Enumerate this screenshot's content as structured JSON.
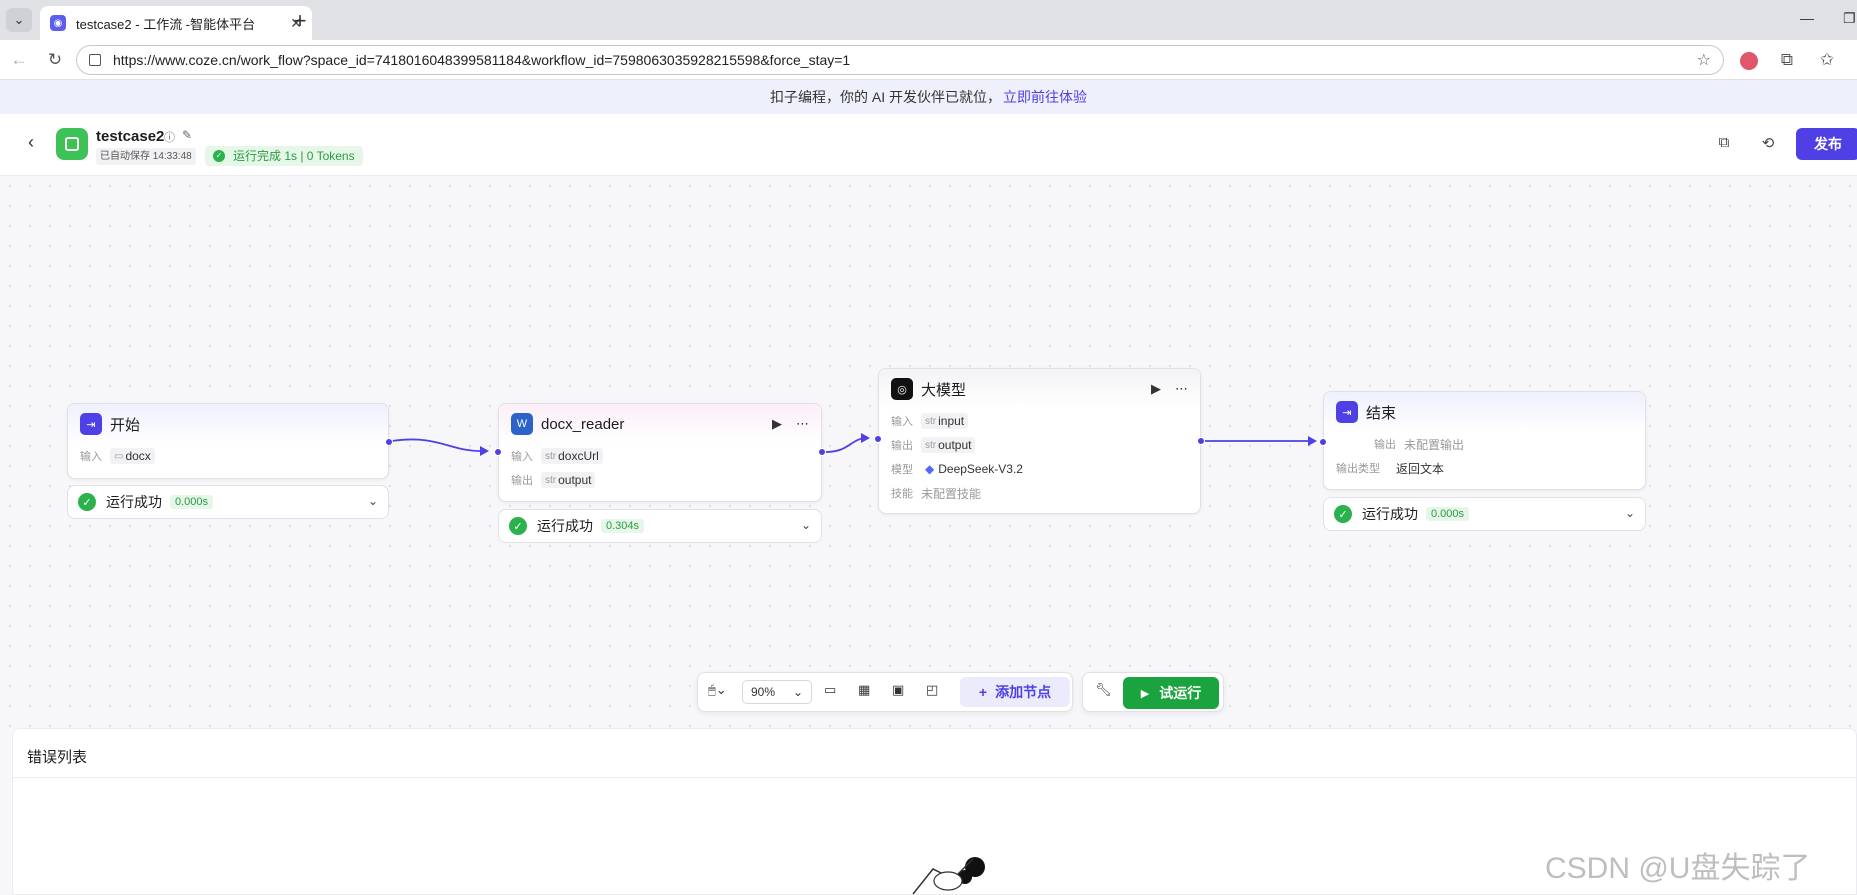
{
  "browser": {
    "tab_title": "testcase2 - 工作流 -智能体平台",
    "url": "https://www.coze.cn/work_flow?space_id=7418016048399581184&workflow_id=7598063035928215598&force_stay=1"
  },
  "banner": {
    "text": "扣子编程，你的 AI 开发伙伴已就位，",
    "link": "立即前往体验"
  },
  "header": {
    "workflow_name": "testcase2",
    "autosave": "已自动保存 14:33:48",
    "run_status": "运行完成 1s | 0 Tokens",
    "publish_label": "发布"
  },
  "nodes": {
    "start": {
      "title": "开始",
      "input_label": "输入",
      "input_value": "docx",
      "result_label": "运行成功",
      "result_time": "0.000s"
    },
    "docx_reader": {
      "title": "docx_reader",
      "input_label": "输入",
      "input_type": "str",
      "input_value": "doxcUrl",
      "output_label": "输出",
      "output_type": "str",
      "output_value": "output",
      "result_label": "运行成功",
      "result_time": "0.304s"
    },
    "llm": {
      "title": "大模型",
      "input_label": "输入",
      "input_type": "str",
      "input_value": "input",
      "output_label": "输出",
      "output_type": "str",
      "output_value": "output",
      "model_label": "模型",
      "model_value": "DeepSeek-V3.2",
      "skill_label": "技能",
      "skill_value": "未配置技能"
    },
    "end": {
      "title": "结束",
      "output_label": "输出",
      "output_value": "未配置输出",
      "output_type_label": "输出类型",
      "output_type_value": "返回文本",
      "result_label": "运行成功",
      "result_time": "0.000s"
    }
  },
  "toolbar": {
    "zoom": "90%",
    "add_node_label": "添加节点",
    "test_run_label": "试运行"
  },
  "error_panel": {
    "title": "错误列表"
  },
  "watermark": "CSDN @U盘失踪了",
  "colors": {
    "accent": "#4e40e5",
    "success": "#2bb24c",
    "run_button": "#1aa33f"
  }
}
